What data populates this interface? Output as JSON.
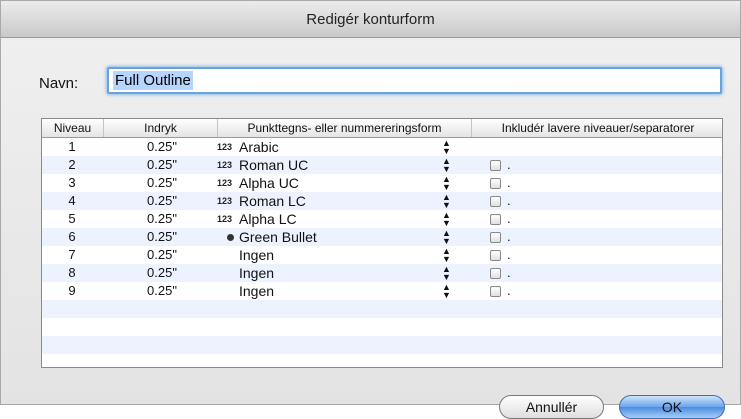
{
  "window": {
    "title": "Redigér konturform"
  },
  "name_field": {
    "label": "Navn:",
    "value": "Full Outline"
  },
  "table": {
    "headers": {
      "level": "Niveau",
      "indent": "Indryk",
      "format": "Punkttegns- eller nummereringsform",
      "include": "Inkludér lavere niveauer/separatorer"
    },
    "rows": [
      {
        "level": "1",
        "indent": "0.25\"",
        "badge": "123",
        "format": "Arabic",
        "has_checkbox": false,
        "separator": ""
      },
      {
        "level": "2",
        "indent": "0.25\"",
        "badge": "123",
        "format": "Roman UC",
        "has_checkbox": true,
        "separator": "."
      },
      {
        "level": "3",
        "indent": "0.25\"",
        "badge": "123",
        "format": "Alpha UC",
        "has_checkbox": true,
        "separator": "."
      },
      {
        "level": "4",
        "indent": "0.25\"",
        "badge": "123",
        "format": "Roman LC",
        "has_checkbox": true,
        "separator": "."
      },
      {
        "level": "5",
        "indent": "0.25\"",
        "badge": "123",
        "format": "Alpha LC",
        "has_checkbox": true,
        "separator": "."
      },
      {
        "level": "6",
        "indent": "0.25\"",
        "badge": "bullet",
        "format": "Green Bullet",
        "has_checkbox": true,
        "separator": "."
      },
      {
        "level": "7",
        "indent": "0.25\"",
        "badge": "",
        "format": "Ingen",
        "has_checkbox": true,
        "separator": "."
      },
      {
        "level": "8",
        "indent": "0.25\"",
        "badge": "",
        "format": "Ingen",
        "has_checkbox": true,
        "separator": "."
      },
      {
        "level": "9",
        "indent": "0.25\"",
        "badge": "",
        "format": "Ingen",
        "has_checkbox": true,
        "separator": "."
      }
    ]
  },
  "buttons": {
    "cancel": "Annullér",
    "ok": "OK"
  },
  "colors": {
    "accent": "#4b8de0",
    "row_alt": "#edf3fe",
    "focus_ring": "#8ebcea"
  }
}
